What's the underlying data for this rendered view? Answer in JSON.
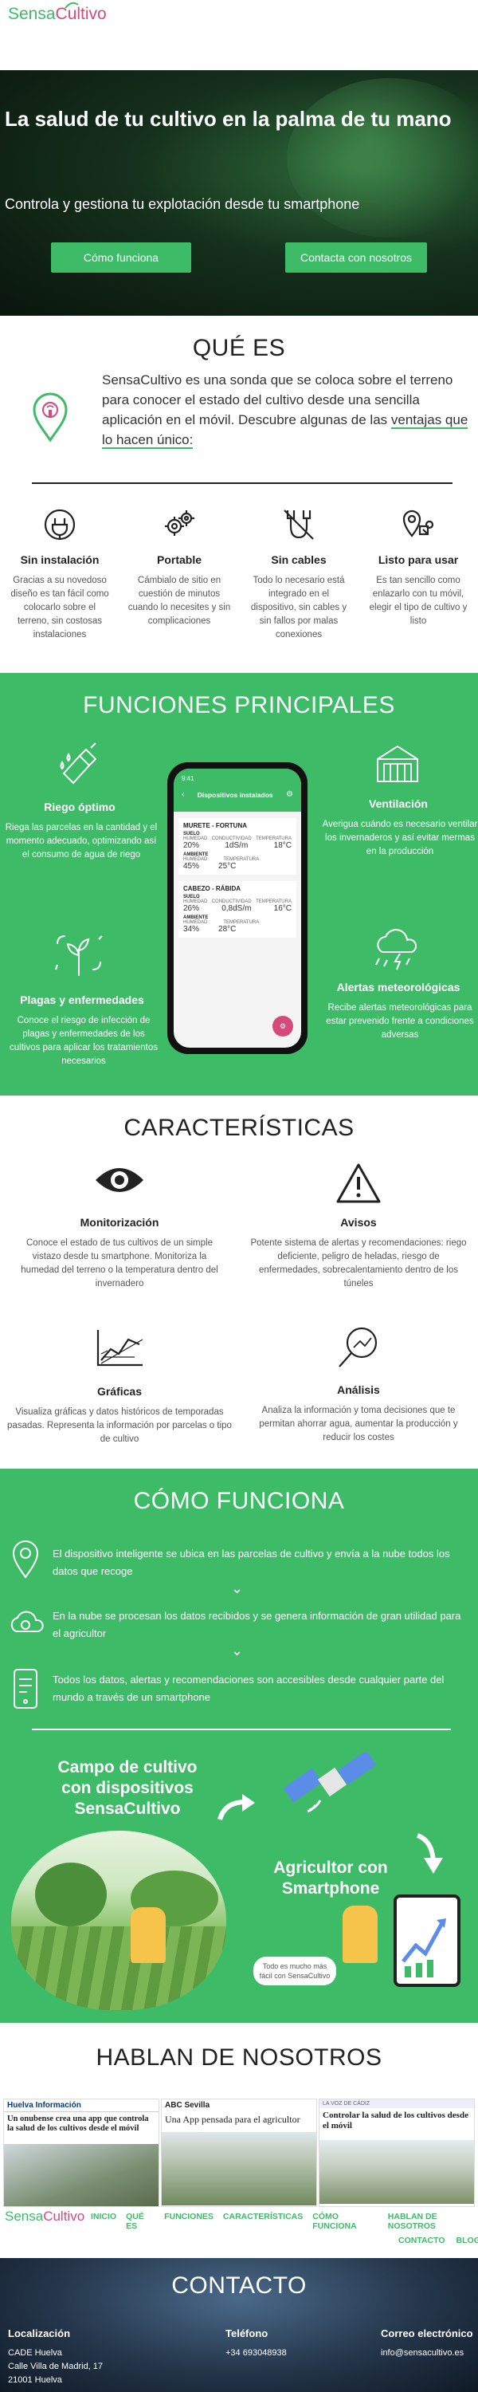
{
  "brand": {
    "name_a": "Sensa",
    "name_b": "Cultivo"
  },
  "hero": {
    "title": "La salud de tu cultivo en la palma de tu mano",
    "subtitle": "Controla y gestiona tu explotación desde tu smartphone",
    "btn_how": "Cómo funciona",
    "btn_contact": "Contacta con nosotros"
  },
  "que_es": {
    "title": "QUÉ ES",
    "text_main": "SensaCultivo es una sonda que se coloca sobre el terreno para conocer el estado del cultivo desde una sencilla aplicación en el móvil. Descubre algunas de las",
    "text_underlined": "ventajas que lo hacen único:",
    "features": [
      {
        "icon": "plug-icon",
        "title": "Sin instalación",
        "text": "Gracias a su novedoso diseño es tan fácil como colocarlo sobre el terreno, sin costosas instalaciones"
      },
      {
        "icon": "gears-icon",
        "title": "Portable",
        "text": "Cámbialo de sitio en cuestión de minutos cuando lo necesites y sin complicaciones"
      },
      {
        "icon": "no-cables-icon",
        "title": "Sin cables",
        "text": "Todo lo necesario está integrado en el dispositivo, sin cables y sin fallos por malas conexiones"
      },
      {
        "icon": "location-pin-icon",
        "title": "Listo para usar",
        "text": "Es tan sencillo como enlazarlo con tu móvil, elegir el tipo de cultivo y listo"
      }
    ]
  },
  "funciones": {
    "title": "FUNCIONES PRINCIPALES",
    "left": [
      {
        "icon": "watering-icon",
        "title": "Riego óptimo",
        "text": "Riega las parcelas en la cantidad y el momento adecuado, optimizando así el consumo de agua de riego"
      },
      {
        "icon": "plant-icon",
        "title": "Plagas y enfermedades",
        "text": "Conoce el riesgo de infección de plagas y enfermedades de los cultivos para aplicar los tratamientos necesarios"
      }
    ],
    "right": [
      {
        "icon": "greenhouse-icon",
        "title": "Ventilación",
        "text": "Averigua cuándo es necesario ventilar los invernaderos y así evitar mermas en la producción"
      },
      {
        "icon": "weather-icon",
        "title": "Alertas meteorológicas",
        "text": "Recibe alertas meteorológicas para estar prevenido frente a condiciones adversas"
      }
    ],
    "phone": {
      "time": "9:41",
      "header": "Dispositivos instalados",
      "devices": [
        {
          "name": "MURETE - FORTUNA",
          "suelo": "SUELO",
          "c1": "HUMEDAD",
          "c2": "CONDUCTIVIDAD",
          "c3": "TEMPERATURA",
          "v1": "20%",
          "v2": "1dS/m",
          "v3": "18°C",
          "amb": "AMBIENTE",
          "a1": "HUMEDAD",
          "a2": "TEMPERATURA",
          "av1": "45%",
          "av2": "25°C"
        },
        {
          "name": "CABEZO - RÁBIDA",
          "suelo": "SUELO",
          "c1": "HUMEDAD",
          "c2": "CONDUCTIVIDAD",
          "c3": "TEMPERATURA",
          "v1": "26%",
          "v2": "0,8dS/m",
          "v3": "16°C",
          "amb": "AMBIENTE",
          "a1": "HUMEDAD",
          "a2": "TEMPERATURA",
          "av1": "34%",
          "av2": "28°C"
        }
      ]
    }
  },
  "caracteristicas": {
    "title": "CARACTERÍSTICAS",
    "items": [
      {
        "icon": "eye-icon",
        "title": "Monitorización",
        "text": "Conoce el estado de tus cultivos de un simple vistazo desde tu smartphone. Monitoriza la humedad del terreno o la temperatura dentro del invernadero"
      },
      {
        "icon": "warning-icon",
        "title": "Avisos",
        "text": "Potente sistema de alertas y recomendaciones: riego deficiente, peligro de heladas, riesgo de enfermedades, sobrecalentamiento dentro de los túneles"
      },
      {
        "icon": "chart-icon",
        "title": "Gráficas",
        "text": "Visualiza gráficas y datos históricos de temporadas pasadas. Representa la información por parcelas o tipo de cultivo"
      },
      {
        "icon": "magnifier-chart-icon",
        "title": "Análisis",
        "text": "Analiza la información y toma decisiones que te permitan ahorrar agua, aumentar la producción y reducir los costes"
      }
    ]
  },
  "como": {
    "title": "CÓMO FUNCIONA",
    "steps": [
      {
        "icon": "pin-device-icon",
        "text": "El dispositivo inteligente se ubica en las parcelas de cultivo y envía a la nube todos los datos que recoge"
      },
      {
        "icon": "cloud-gear-icon",
        "text": "En la nube se procesan los datos recibidos y se genera información de gran utilidad para el agricultor"
      },
      {
        "icon": "phone-data-icon",
        "text": "Todos los datos, alertas y recomendaciones son accesibles desde cualquier parte del mundo a través de un smartphone"
      }
    ],
    "illus_left": "Campo de cultivo con dispositivos SensaCultivo",
    "illus_right": "Agricultor con Smartphone",
    "bubble": "Todo es mucho más fácil con SensaCultivo"
  },
  "hablan": {
    "title": "HABLAN DE NOSOTROS",
    "news": [
      {
        "source": "Huelva Información",
        "headline": "Un onubense crea una app que controla la salud de los cultivos desde el móvil"
      },
      {
        "source": "ABC Sevilla",
        "headline": "Una App pensada para el agricultor"
      },
      {
        "source": "LA VOZ DE CÁDIZ",
        "headline": "Controlar la salud de los cultivos desde el móvil"
      }
    ]
  },
  "nav": {
    "items": [
      "INICIO",
      "QUÉ ES",
      "FUNCIONES",
      "CARACTERÍSTICAS",
      "CÓMO FUNCIONA",
      "HABLAN DE NOSOTROS"
    ],
    "items2": [
      "CONTACTO",
      "BLOG"
    ]
  },
  "contacto": {
    "title": "CONTACTO",
    "loc_label": "Localización",
    "loc_1": "CADE Huelva",
    "loc_2": "Calle Villa de Madrid, 17",
    "loc_3": "21001 Huelva",
    "tel_label": "Teléfono",
    "tel": "+34 693048938",
    "mail_label": "Correo electrónico",
    "mail": "info@sensacultivo.es"
  }
}
